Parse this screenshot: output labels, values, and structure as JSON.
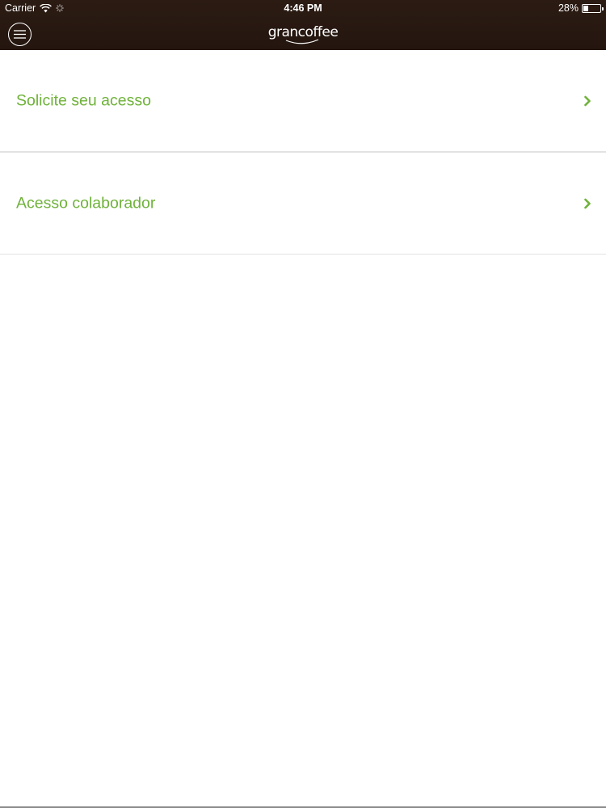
{
  "status_bar": {
    "carrier": "Carrier",
    "time": "4:46 PM",
    "battery": "28%",
    "battery_level": 0.28,
    "icons": [
      "wifi-icon",
      "activity-icon",
      "battery-icon"
    ]
  },
  "header": {
    "logo_text": "grancoffee",
    "menu_icon": "hamburger-menu-icon",
    "background_color": "#2a1a12"
  },
  "menu": {
    "accent_color": "#6fb23a",
    "items": [
      {
        "label": "Solicite seu acesso",
        "icon": "chevron-right-icon"
      },
      {
        "label": "Acesso colaborador",
        "icon": "chevron-right-icon"
      }
    ]
  }
}
